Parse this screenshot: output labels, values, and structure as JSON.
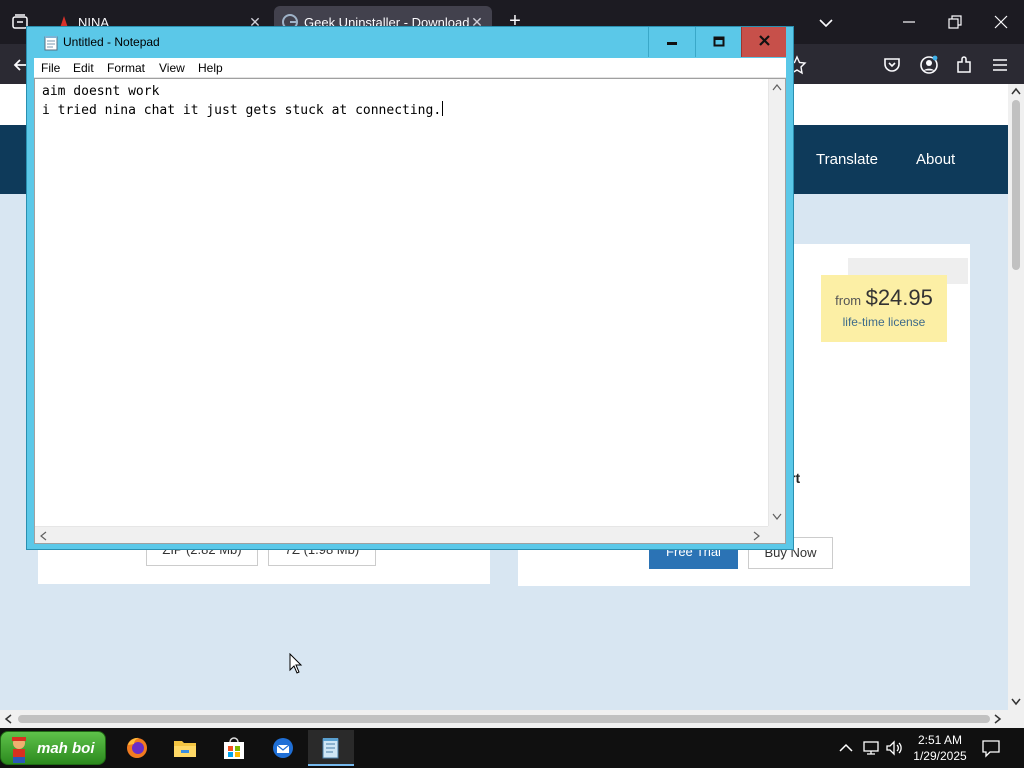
{
  "browser": {
    "tabs": [
      {
        "title": "NINA"
      },
      {
        "title": "Geek Uninstaller - Download"
      }
    ],
    "new_tab": "+"
  },
  "page": {
    "nav": [
      "Translate",
      "About"
    ],
    "price": {
      "from": "from",
      "value": "$24.95",
      "license": "life-time license"
    },
    "downloads": [
      "ZIP (2.82 Mb)",
      "7Z (1.98 Mb)"
    ],
    "buttons": {
      "trial": "Free Trial",
      "buy": "Buy Now"
    },
    "partial_heading": "rt"
  },
  "notepad": {
    "title": "Untitled - Notepad",
    "menu": [
      "File",
      "Edit",
      "Format",
      "View",
      "Help"
    ],
    "content": "aim doesnt work\ni tried nina chat it just gets stuck at connecting."
  },
  "taskbar": {
    "start_label": "mah boi",
    "apps": [
      "firefox-icon",
      "file-explorer-icon",
      "store-icon",
      "thunderbird-icon",
      "notepad-icon"
    ],
    "clock": {
      "time": "2:51 AM",
      "date": "1/29/2025"
    }
  },
  "colors": {
    "notepad_frame": "#5bc8e8",
    "close_button": "#c7504a",
    "nav_bar": "#0e3a5a",
    "price_box": "#fcefa5"
  }
}
